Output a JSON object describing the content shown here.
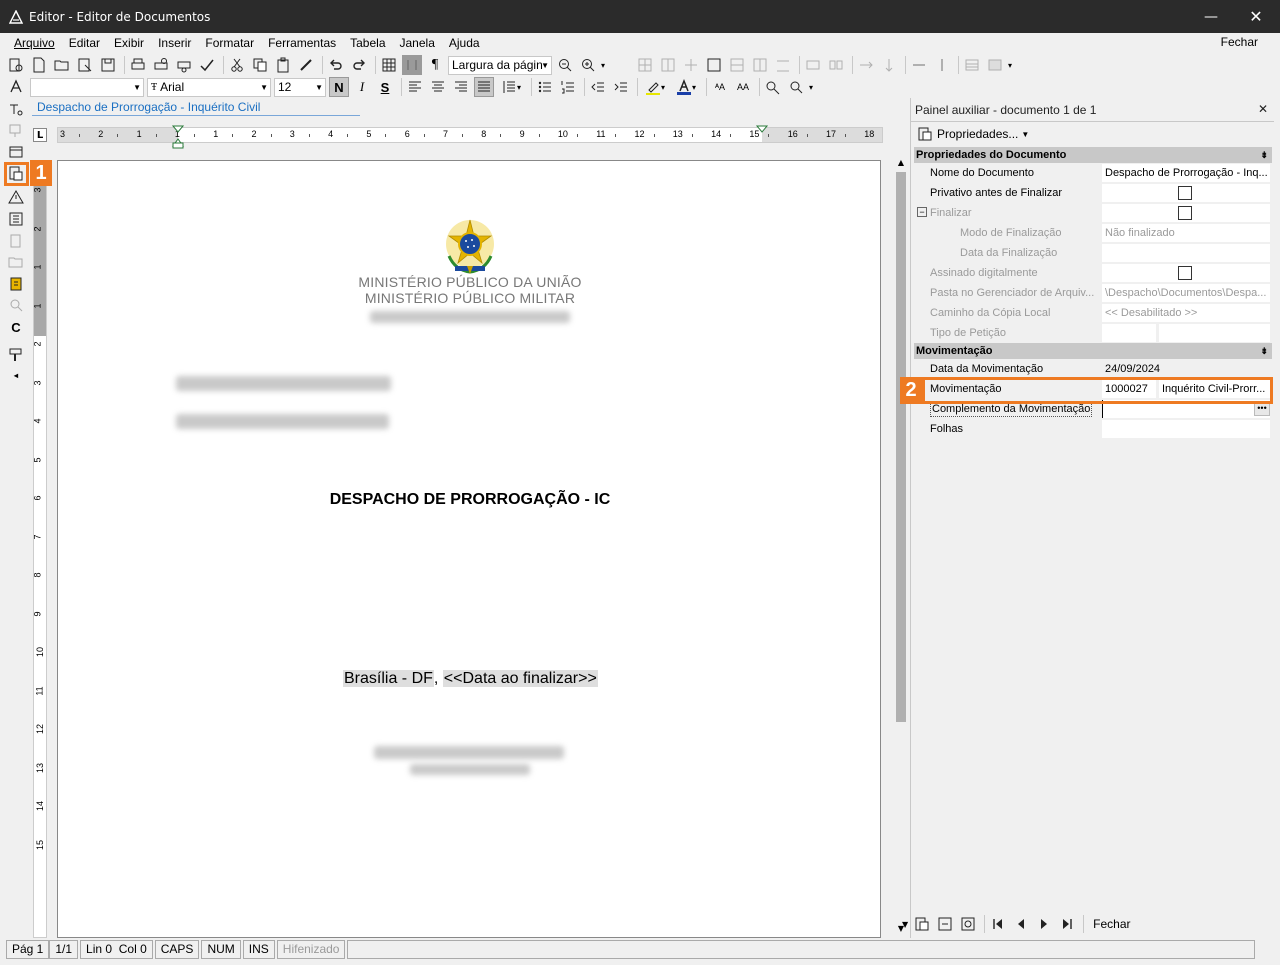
{
  "window": {
    "title": "Editor - Editor de Documentos",
    "minimize": "—",
    "close": "✕"
  },
  "menu": {
    "items": [
      "Arquivo",
      "Editar",
      "Exibir",
      "Inserir",
      "Formatar",
      "Ferramentas",
      "Tabela",
      "Janela",
      "Ajuda"
    ],
    "close_label": "Fechar"
  },
  "toolbar": {
    "zoom_value": "Largura da págin",
    "font_name": "Arial",
    "font_size": "12",
    "bold_label": "N",
    "italic_label": "I",
    "strike_label": "S"
  },
  "document_tab": "Despacho de Prorrogação - Inquérito Civil",
  "ruler": {
    "h_numbers": [
      "3",
      "2",
      "1",
      "1",
      "1",
      "2",
      "3",
      "4",
      "5",
      "6",
      "7",
      "8",
      "9",
      "10",
      "11",
      "12",
      "13",
      "14",
      "15",
      "16",
      "17",
      "18"
    ],
    "v_numbers": [
      "3",
      "2",
      "1",
      "1",
      "2",
      "3",
      "4",
      "5",
      "6",
      "7",
      "8",
      "9",
      "10",
      "11",
      "12",
      "13",
      "14",
      "15"
    ]
  },
  "document": {
    "ministry_line1": "MINISTÉRIO PÚBLICO DA UNIÃO",
    "ministry_line2": "MINISTÉRIO PÚBLICO MILITAR",
    "heading": "DESPACHO DE PRORROGAÇÃO - IC",
    "place": "Brasília - DF",
    "date_placeholder": "<<Data ao finalizar>>"
  },
  "statusbar": {
    "page": "Pág 1",
    "pages": "1/1",
    "linecol": "Lin 0  Col 0",
    "caps": "CAPS",
    "num": "NUM",
    "ins": "INS",
    "hyphen": "Hifenizado"
  },
  "panel": {
    "title": "Painel auxiliar - documento 1 de 1",
    "close": "✕",
    "props_label": "Propriedades...",
    "group1": "Propriedades do Documento",
    "group2": "Movimentação",
    "rows": {
      "doc_name_key": "Nome do Documento",
      "doc_name_val": "Despacho de Prorrogação - Inq...",
      "private_key": "Privativo antes de Finalizar",
      "finalize_key": "Finalizar",
      "finalize_mode_key": "Modo de Finalização",
      "finalize_mode_val": "Não finalizado",
      "finalize_date_key": "Data da Finalização",
      "signed_key": "Assinado digitalmente",
      "folder_key": "Pasta no Gerenciador de Arquiv...",
      "folder_val": "\\Despacho\\Documentos\\Despa...",
      "local_path_key": "Caminho da Cópia Local",
      "local_path_val": "<< Desabilitado >>",
      "petition_type_key": "Tipo de Petição",
      "move_date_key": "Data da Movimentação",
      "move_date_val": "24/09/2024",
      "move_key": "Movimentação",
      "move_code": "1000027",
      "move_val": "Inquérito Civil-Prorr...",
      "complement_key": "Complemento da Movimentação",
      "sheets_key": "Folhas"
    },
    "footer_close": "Fechar"
  },
  "callouts": {
    "one": "1",
    "two": "2"
  },
  "colors": {
    "titlebar": "#2b2b2b",
    "callout": "#ee7a22",
    "group_header": "#c8c8c8"
  }
}
